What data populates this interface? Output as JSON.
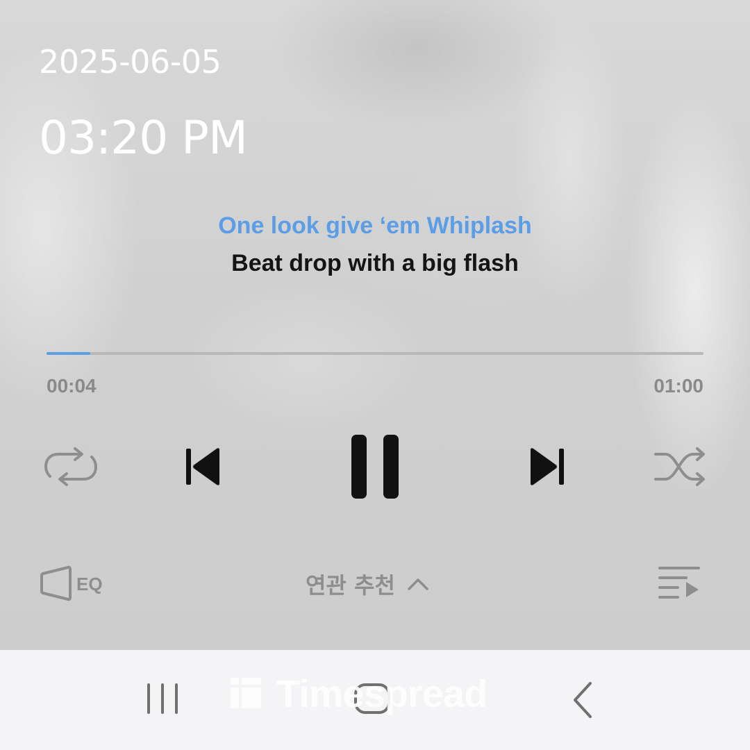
{
  "status": {
    "date": "2025-06-05",
    "time": "03:20 PM"
  },
  "lyrics": {
    "current_line": "One look give ‘em Whiplash",
    "next_line": "Beat drop with a big flash"
  },
  "playback": {
    "elapsed": "00:04",
    "total": "01:00",
    "progress_fraction": 0.067,
    "state": "playing"
  },
  "controls": {
    "repeat_icon": "repeat-icon",
    "previous_icon": "skip-previous-icon",
    "play_pause_icon": "pause-icon",
    "next_icon": "skip-next-icon",
    "shuffle_icon": "shuffle-icon"
  },
  "bottom_bar": {
    "eq_label": "EQ",
    "related_label": "연관 추천",
    "related_icon": "chevron-up-icon",
    "playlist_icon": "playlist-icon"
  },
  "navbar": {
    "recent_apps_icon": "recent-apps-icon",
    "home_icon": "home-icon",
    "back_icon": "back-icon"
  },
  "watermark": {
    "text": "Timespread"
  },
  "colors": {
    "accent": "#5c9ee6",
    "primary_text": "#141414",
    "secondary_text": "#8a8a8a",
    "overlay_text": "#ffffff",
    "nav_background": "#f4f4f6"
  }
}
